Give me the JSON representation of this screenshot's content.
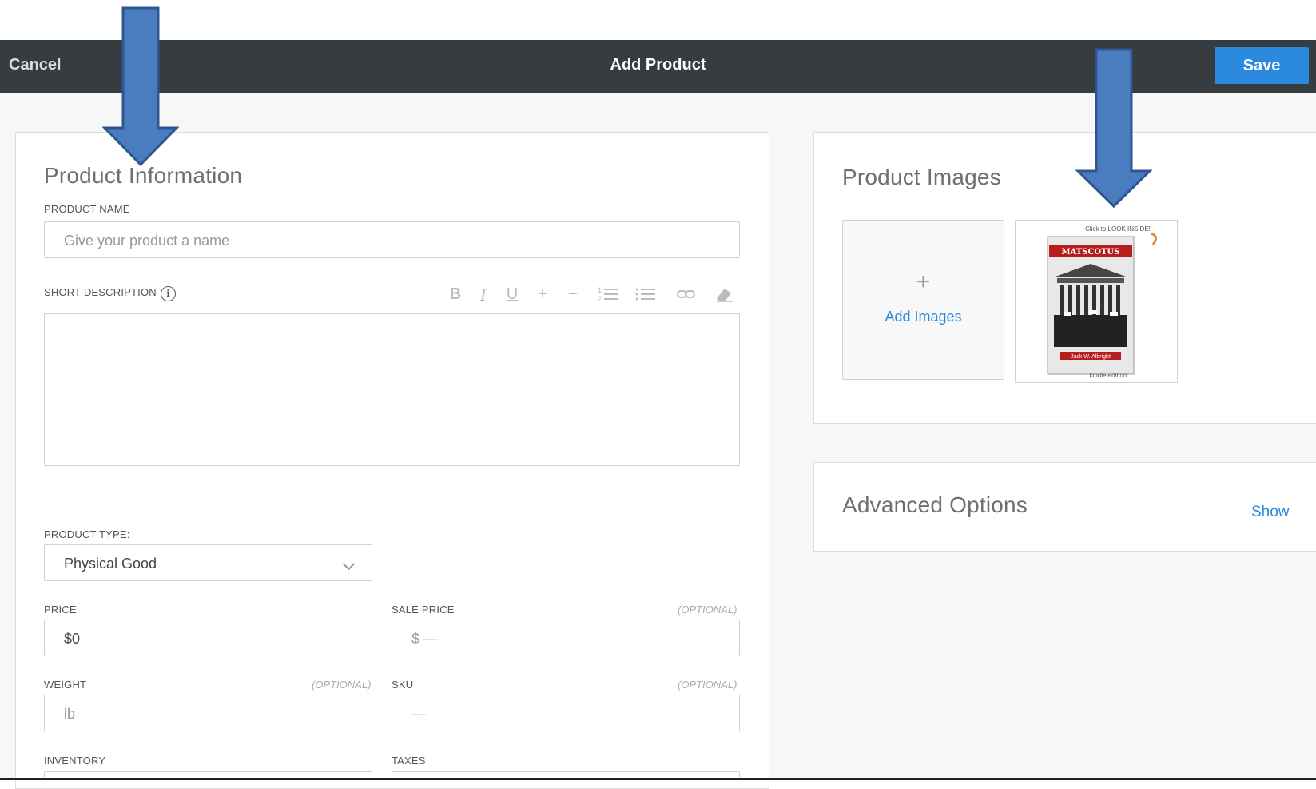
{
  "header": {
    "cancel_label": "Cancel",
    "title": "Add Product",
    "save_label": "Save"
  },
  "product_info": {
    "heading": "Product Information",
    "product_name_label": "PRODUCT NAME",
    "product_name_placeholder": "Give your product a name",
    "short_description_label": "SHORT DESCRIPTION",
    "toolbar": [
      "B",
      "I",
      "U",
      "+",
      "−",
      "1≡",
      "☰",
      "⊂⊃",
      "⌫"
    ],
    "product_type_label": "PRODUCT TYPE:",
    "product_type_value": "Physical Good",
    "price_label": "PRICE",
    "price_value": "$0",
    "sale_price_label": "SALE PRICE",
    "sale_price_placeholder": "$ —",
    "weight_label": "WEIGHT",
    "weight_placeholder": "lb",
    "sku_label": "SKU",
    "sku_placeholder": "—",
    "optional_label": "(OPTIONAL)",
    "inventory_label": "INVENTORY",
    "taxes_label": "TAXES"
  },
  "product_images": {
    "heading": "Product Images",
    "add_images_plus": "+",
    "add_images_label": "Add Images",
    "thumb_top_text": "Click to LOOK INSIDE!",
    "thumb_title": "MATSCOTUS",
    "thumb_author": "Jack W. Albright",
    "thumb_bottom_text": "kindle edition"
  },
  "advanced_options": {
    "heading": "Advanced Options",
    "show_label": "Show"
  },
  "colors": {
    "topbar": "#373c41",
    "accent": "#2b8ae0",
    "arrow": "#4a7cc0"
  }
}
